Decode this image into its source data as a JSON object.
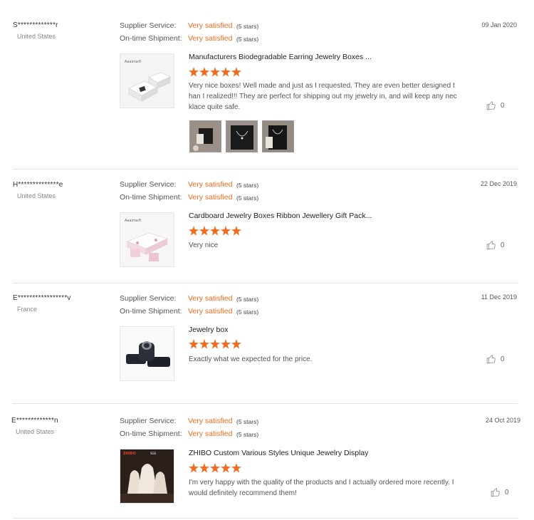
{
  "reviews": [
    {
      "user": "S*************r",
      "country": "United States",
      "supplier_label": "Supplier Service:",
      "supplier_value": "Very satisfied",
      "supplier_stars": "(5 stars)",
      "shipment_label": "On-time Shipment:",
      "shipment_value": "Very satisfied",
      "shipment_stars": "(5 stars)",
      "date": "09 Jan 2020",
      "product_title": "Manufacturers Biodegradable Earring Jewelry Boxes ...",
      "rating": 5,
      "thumb_brand": "Aaaima®",
      "text": "Very nice boxes!  Well made and just as I requested.  They are even better designed than I realized!!!  They are perfect for shipping out my jewelry in, and will keep any necklace quite safe.",
      "likes": "0",
      "photos": [
        "review-photo-1",
        "review-photo-2",
        "review-photo-3"
      ]
    },
    {
      "user": "H**************e",
      "country": "United States",
      "supplier_label": "Supplier Service:",
      "supplier_value": "Very satisfied",
      "supplier_stars": "(5 stars)",
      "shipment_label": "On-time Shipment:",
      "shipment_value": "Very satisfied",
      "shipment_stars": "(5 stars)",
      "date": "22 Dec 2019",
      "product_title": "Cardboard Jewelry Boxes Ribbon Jewellery Gift Pack...",
      "rating": 5,
      "thumb_brand": "Aaaima®",
      "text": "Very nice",
      "likes": "0"
    },
    {
      "user": "E*****************v",
      "country": "France",
      "supplier_label": "Supplier Service:",
      "supplier_value": "Very satisfied",
      "supplier_stars": "(5 stars)",
      "shipment_label": "On-time Shipment:",
      "shipment_value": "Very satisfied",
      "shipment_stars": "(5 stars)",
      "date": "11 Dec 2019",
      "product_title": "Jewelry box",
      "rating": 5,
      "text": "Exactly what we expected for the price.",
      "likes": "0"
    },
    {
      "user": "E*************n",
      "country": "United States",
      "supplier_label": "Supplier Service:",
      "supplier_value": "Very satisfied",
      "supplier_stars": "(5 stars)",
      "shipment_label": "On-time Shipment:",
      "shipment_value": "Very satisfied",
      "shipment_stars": "(5 stars)",
      "date": "24 Oct 2019",
      "product_title": "ZHIBO Custom Various Styles Unique Jewelry Display",
      "rating": 5,
      "thumb_brand": "ZHIBO",
      "thumb_badge": "SGS",
      "text": "I'm very happy with the quality of the products and I actually ordered more recently. I would definitely recommend them!",
      "likes": "0"
    }
  ],
  "colors": {
    "accent": "#f26b1d",
    "divider": "#e3e3e3"
  },
  "icons": {
    "like": "thumbs-up-icon",
    "star": "star-icon"
  }
}
